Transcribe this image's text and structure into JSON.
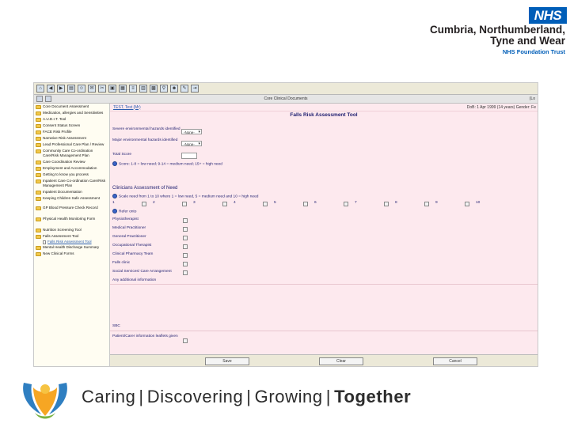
{
  "brand": {
    "nhs_logo": "NHS",
    "trust_line1": "Cumbria, Northumberland,",
    "trust_line2": "Tyne and Wear",
    "trust_sub": "NHS Foundation Trust",
    "slogan": [
      "Caring",
      "Discovering",
      "Growing",
      "Together"
    ],
    "colors": {
      "nhs_blue": "#005eb8",
      "form_bg": "#fde9ee",
      "sidebar_bg": "#fffdf2"
    }
  },
  "app": {
    "toolbar_center": "Core Clinical Documents",
    "toolbar_right": "(Lo",
    "patient_link": "TEST, Test (Mr)",
    "patient_right": "DoB: 1 Apr 1999 (14 years)  Gender: Fe",
    "form_title": "Falls Risk Assessment Tool",
    "sidebar": [
      {
        "label": "Core Document Assessment"
      },
      {
        "label": "Medication, allergies and Sensitivities"
      },
      {
        "label": "A.U.D.I.T. Tool"
      },
      {
        "label": "Consent Status Screen"
      },
      {
        "label": "FACE Risk Profile"
      },
      {
        "label": "Narrative Risk Assessment"
      },
      {
        "label": "Lead Professional Care Plan / Review"
      },
      {
        "label": "Community Care Co-ordination Care/Risk Management Plan"
      },
      {
        "label": "Care Coordination Review"
      },
      {
        "label": "Employment and Accommodation"
      },
      {
        "label": "Getting to know you process"
      },
      {
        "label": "Inpatient Care Co-ordination Care/Risk Management Plan"
      },
      {
        "label": "Inpatient Documentation"
      },
      {
        "label": "Keeping Children Safe Assessment"
      },
      {
        "label": "GP Blood Pressure Check Record"
      },
      {
        "label": "Physical Health Monitoring Form"
      },
      {
        "label": "Nutrition Screening Tool"
      },
      {
        "label": "Falls Assessment Tool"
      },
      {
        "label": "Falls Risk Assessment Tool",
        "child": true
      },
      {
        "label": "Mental Health Discharge Summary"
      },
      {
        "label": "New Clinical Forms"
      }
    ],
    "fields": {
      "severe_hazards_label": "Severe environmental hazards identified",
      "severe_hazards_value": "-None-",
      "major_hazards_label": "Major environmental hazards identified",
      "major_hazards_value": "-None-",
      "total_score_label": "Total Score",
      "score_note": "Score: 1-8 = low need; 9-14 = medium need; 15+ = high need"
    },
    "clinician": {
      "title": "Clinicians Assessment of Need",
      "scale_label": "Scale need from 1 to 10 where 1 = low need, 5 = medium need and 10 = high need",
      "scale_values": [
        "1",
        "2",
        "3",
        "4",
        "5",
        "6",
        "7",
        "8",
        "9",
        "10"
      ],
      "refer_onto": "Refer onto",
      "referrals": [
        "Physiotherapist",
        "Medical Practitioner",
        "General Practitioner",
        "Occupational Therapist",
        "Clinical Pharmacy Team",
        "Falls clinic",
        "Social Services/ Care Arrangement"
      ],
      "additional_info": "Any additional information"
    },
    "bottom": {
      "sbc_label": "SBC",
      "leaflet_label": "Patient/Carer information leaflets given"
    },
    "buttons": {
      "save": "Save",
      "clear": "Clear",
      "cancel": "Cancel"
    }
  }
}
